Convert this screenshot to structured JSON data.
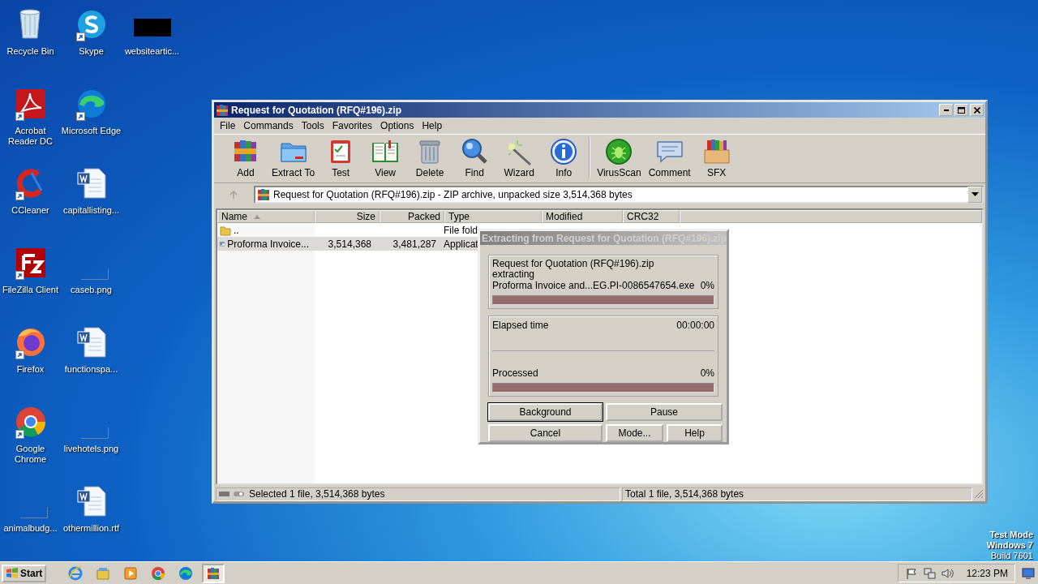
{
  "desktop": {
    "icons": [
      {
        "label": "Recycle Bin",
        "kind": "recycle",
        "shortcut": false
      },
      {
        "label": "Acrobat Reader DC",
        "kind": "acrobat",
        "shortcut": true
      },
      {
        "label": "CCleaner",
        "kind": "ccleaner",
        "shortcut": true
      },
      {
        "label": "FileZilla Client",
        "kind": "filezilla",
        "shortcut": true
      },
      {
        "label": "Firefox",
        "kind": "firefox",
        "shortcut": true
      },
      {
        "label": "Google Chrome",
        "kind": "chrome",
        "shortcut": true
      },
      {
        "label": "animalbudg...",
        "kind": "image",
        "shortcut": false
      },
      {
        "label": "Skype",
        "kind": "skype",
        "shortcut": true
      },
      {
        "label": "Microsoft Edge",
        "kind": "edge",
        "shortcut": true
      },
      {
        "label": "capitallisting...",
        "kind": "word",
        "shortcut": false
      },
      {
        "label": "caseb.png",
        "kind": "image",
        "shortcut": false
      },
      {
        "label": "functionspa...",
        "kind": "word",
        "shortcut": false
      },
      {
        "label": "livehotels.png",
        "kind": "image",
        "shortcut": false
      },
      {
        "label": "othermillion.rtf",
        "kind": "word",
        "shortcut": false
      },
      {
        "label": "websiteartic...",
        "kind": "redacted",
        "shortcut": false
      }
    ],
    "notice": [
      "Test Mode",
      "Windows 7",
      "Build 7601"
    ]
  },
  "window": {
    "title": "Request for Quotation (RFQ#196).zip",
    "menu": [
      "File",
      "Commands",
      "Tools",
      "Favorites",
      "Options",
      "Help"
    ],
    "toolbar": [
      {
        "label": "Add",
        "kind": "add"
      },
      {
        "label": "Extract To",
        "kind": "extract"
      },
      {
        "label": "Test",
        "kind": "test"
      },
      {
        "label": "View",
        "kind": "view"
      },
      {
        "label": "Delete",
        "kind": "delete"
      },
      {
        "label": "Find",
        "kind": "find"
      },
      {
        "label": "Wizard",
        "kind": "wizard"
      },
      {
        "label": "Info",
        "kind": "info"
      },
      {
        "label": "VirusScan",
        "kind": "virus",
        "group_start": true
      },
      {
        "label": "Comment",
        "kind": "comment"
      },
      {
        "label": "SFX",
        "kind": "sfx"
      }
    ],
    "address": "Request for Quotation (RFQ#196).zip - ZIP archive, unpacked size 3,514,368 bytes",
    "columns": [
      {
        "label": "Name",
        "sorted": true
      },
      {
        "label": "Size",
        "sorted": false
      },
      {
        "label": "Packed",
        "sorted": false
      },
      {
        "label": "Type",
        "sorted": false
      },
      {
        "label": "Modified",
        "sorted": false
      },
      {
        "label": "CRC32",
        "sorted": false
      }
    ],
    "rows": [
      {
        "kind": "folder",
        "name": "..",
        "size": "",
        "packed": "",
        "type": "File fold",
        "selected": false
      },
      {
        "kind": "exe",
        "name": "Proforma Invoice...",
        "size": "3,514,368",
        "packed": "3,481,287",
        "type": "Applicat",
        "selected": true
      }
    ],
    "status": {
      "left": "Selected 1 file, 3,514,368 bytes",
      "right": "Total 1 file, 3,514,368 bytes"
    }
  },
  "dialog": {
    "title": "Extracting from Request for Quotation (RFQ#196).zip",
    "archive": "Request for Quotation (RFQ#196).zip",
    "action": "extracting",
    "file": "Proforma Invoice and...EG.PI-0086547654.exe",
    "file_percent": "0%",
    "file_progress": {
      "level": 0
    },
    "elapsed_label": "Elapsed time",
    "elapsed": "00:00:00",
    "processed_label": "Processed",
    "processed_percent": "0%",
    "processed_progress": {
      "level": 0
    },
    "buttons": [
      {
        "label": "Background",
        "default": true
      },
      {
        "label": "Pause",
        "default": false
      },
      {
        "label": "Cancel",
        "default": false
      },
      {
        "label": "Mode...",
        "default": false
      },
      {
        "label": "Help",
        "default": false
      }
    ]
  },
  "taskbar": {
    "start": "Start",
    "apps": [
      {
        "kind": "ie",
        "active": false
      },
      {
        "kind": "explorer",
        "active": false
      },
      {
        "kind": "media",
        "active": false
      },
      {
        "kind": "chrome",
        "active": false
      },
      {
        "kind": "edge",
        "active": false
      },
      {
        "kind": "winrar",
        "active": true
      }
    ],
    "clock": "12:23 PM"
  }
}
